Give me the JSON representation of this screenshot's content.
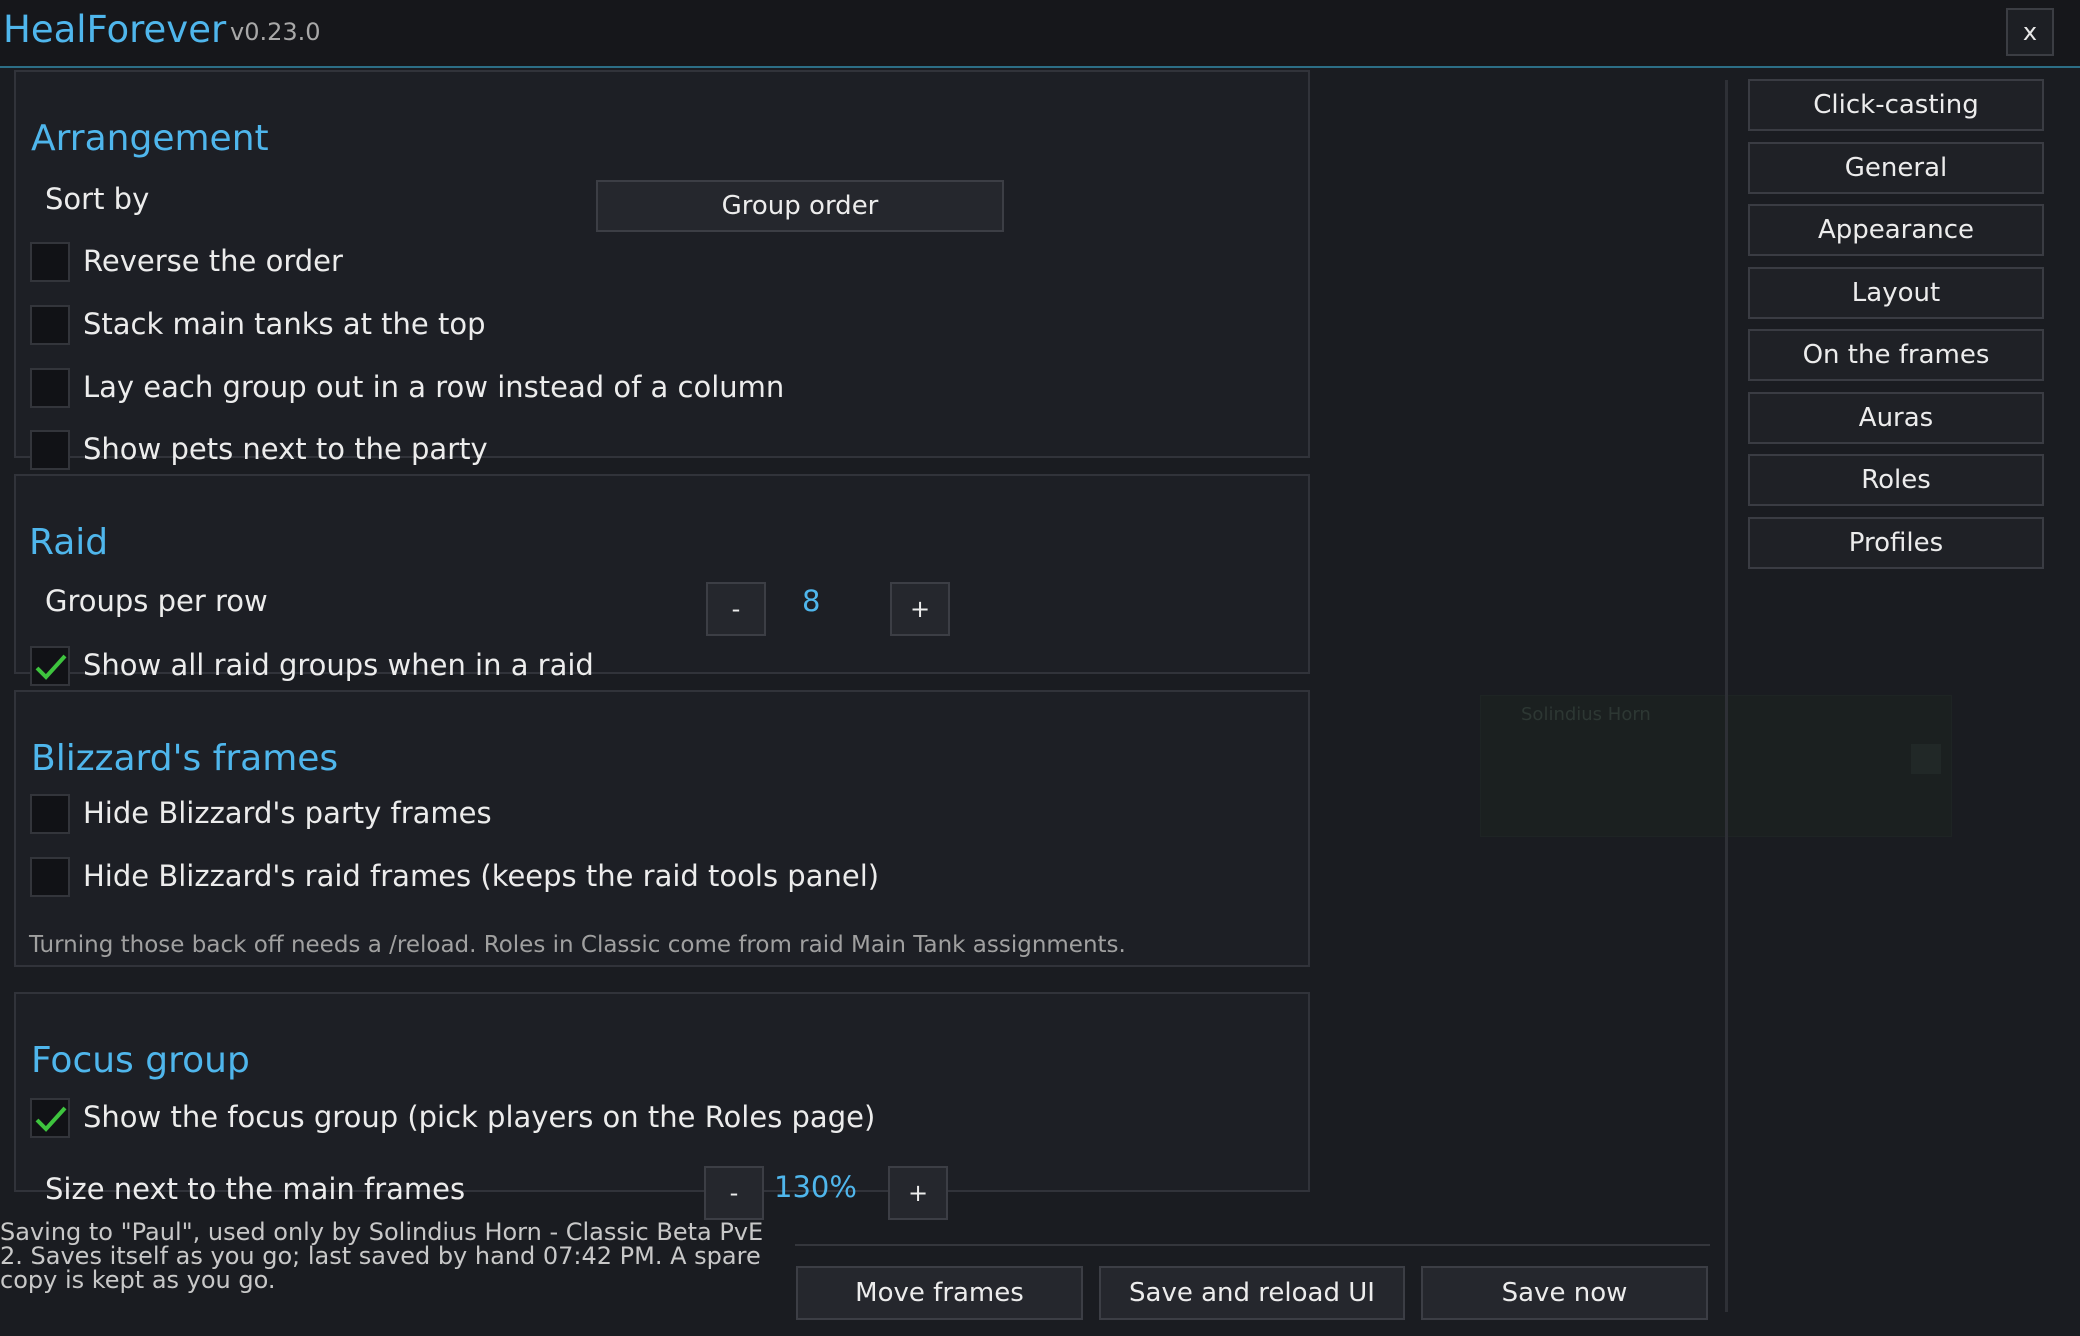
{
  "app": {
    "title": "HealForever",
    "version": "v0.23.0",
    "close_label": "x"
  },
  "arrangement": {
    "title": "Arrangement",
    "sort_by_label": "Sort by",
    "sort_by_value": "Group order",
    "options": [
      {
        "label": "Reverse the order",
        "checked": false
      },
      {
        "label": "Stack main tanks at the top",
        "checked": false
      },
      {
        "label": "Lay each group out in a row instead of a column",
        "checked": false
      },
      {
        "label": "Show pets next to the party",
        "checked": false
      }
    ]
  },
  "raid": {
    "title": "Raid",
    "groups_per_row_label": "Groups per row",
    "groups_per_row_value": "8",
    "minus_label": "-",
    "plus_label": "+",
    "show_all_label": "Show all raid groups when in a raid",
    "show_all_checked": true
  },
  "blizzard": {
    "title": "Blizzard's frames",
    "hide_party_label": "Hide Blizzard's party frames",
    "hide_party_checked": false,
    "hide_raid_label": "Hide Blizzard's raid frames (keeps the raid tools panel)",
    "hide_raid_checked": false,
    "note": "Turning those back off needs a /reload. Roles in Classic come from raid Main Tank assignments."
  },
  "focus": {
    "title": "Focus group",
    "show_label": "Show the focus group (pick players on the Roles page)",
    "show_checked": true,
    "size_label": "Size next to the main frames",
    "size_value": "130%",
    "minus_label": "-",
    "plus_label": "+"
  },
  "nav": {
    "items": [
      "Click-casting",
      "General",
      "Appearance",
      "Layout",
      "On the frames",
      "Auras",
      "Roles",
      "Profiles"
    ]
  },
  "preview": {
    "name": "Solindius Horn"
  },
  "footer": {
    "status": "Saving to \"Paul\", used only by Solindius Horn - Classic Beta PvE 2. Saves itself as you go; last saved by hand 07:42 PM. A spare copy is kept as you go.",
    "move_frames": "Move frames",
    "save_reload": "Save and reload UI",
    "save_now": "Save now"
  },
  "colors": {
    "accent": "#4fb6ec",
    "check": "#3ec43e",
    "background": "#1a1c21"
  }
}
